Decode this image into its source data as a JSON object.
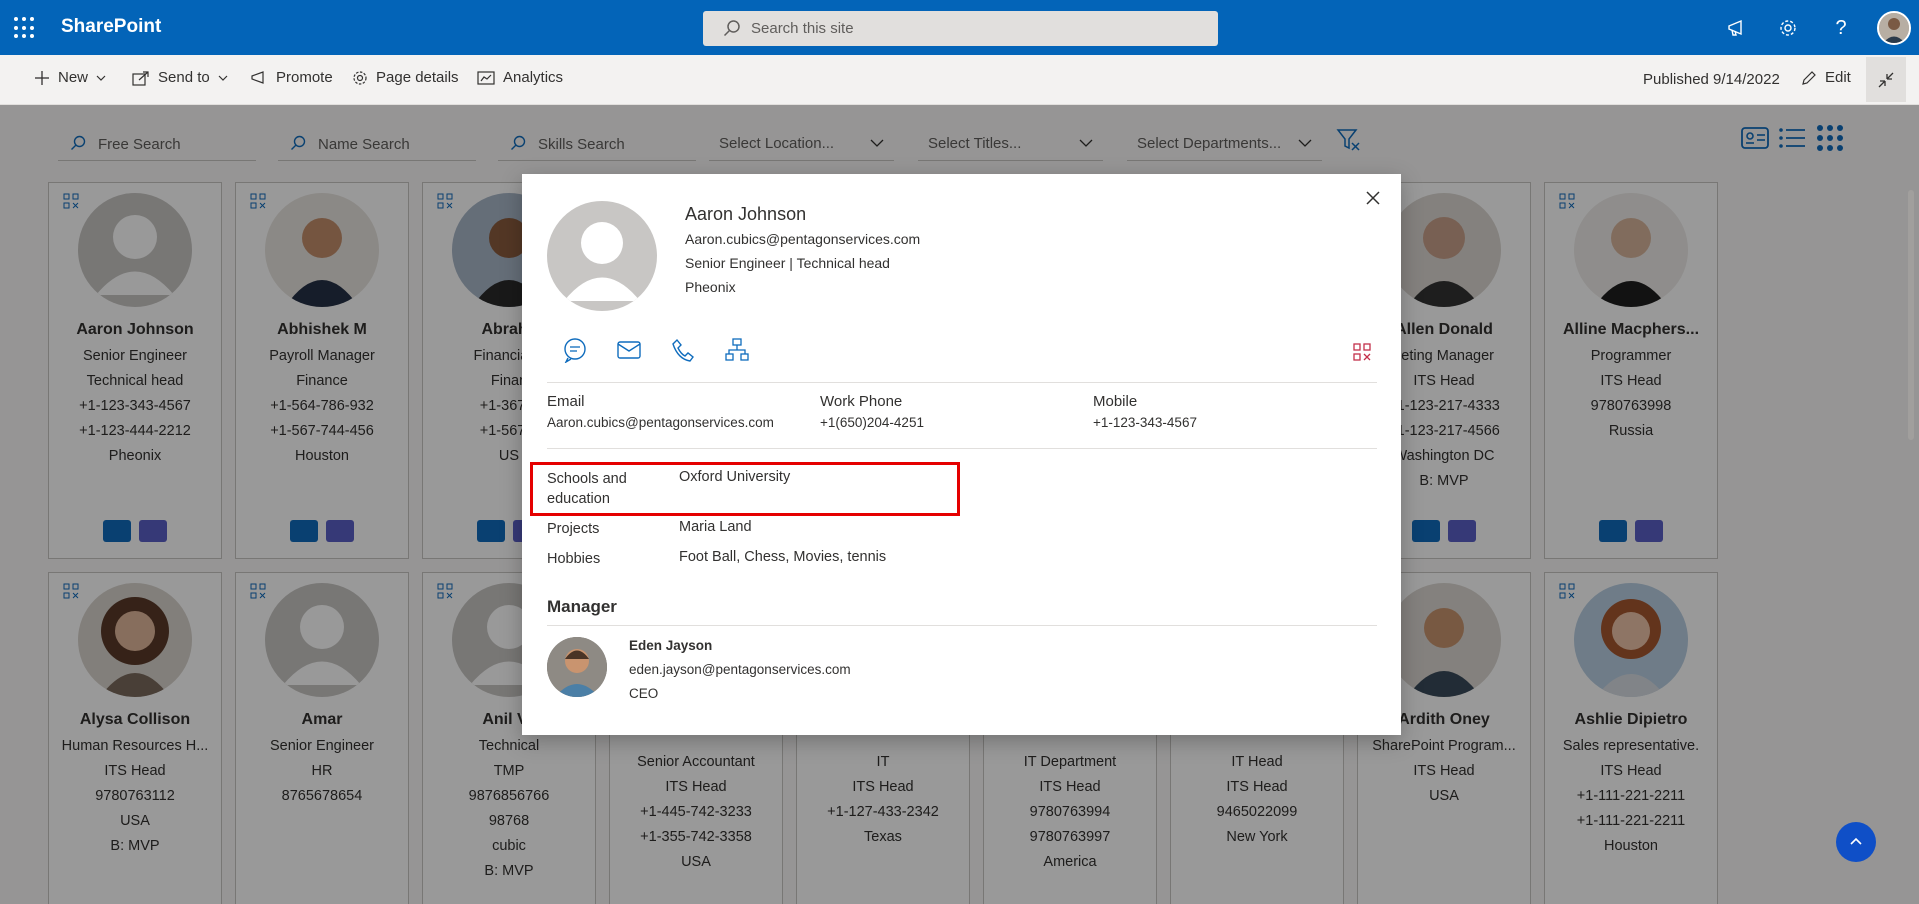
{
  "suitebar": {
    "app_name": "SharePoint",
    "search_placeholder": "Search this site"
  },
  "commandbar": {
    "new": "New",
    "send_to": "Send to",
    "promote": "Promote",
    "page_details": "Page details",
    "analytics": "Analytics",
    "published": "Published 9/14/2022",
    "edit": "Edit"
  },
  "filters": {
    "free_search": "Free Search",
    "name_search": "Name Search",
    "skills_search": "Skills Search",
    "location": "Select Location...",
    "titles": "Select Titles...",
    "departments": "Select Departments..."
  },
  "cards_row1": [
    {
      "name": "Aaron Johnson",
      "l1": "Senior Engineer",
      "l2": "Technical head",
      "l3": "+1-123-343-4567",
      "l4": "+1-123-444-2212",
      "l5": "Pheonix"
    },
    {
      "name": "Abhishek M",
      "l1": "Payroll Manager",
      "l2": "Finance",
      "l3": "+1-564-786-932",
      "l4": "+1-567-744-456",
      "l5": "Houston"
    },
    {
      "name": "Abraha",
      "l1": "Financial A",
      "l2": "Finan",
      "l3": "+1-367-3",
      "l4": "+1-567-3",
      "l5": "US"
    },
    {
      "name": "Allen Donald",
      "l1": "keting Manager",
      "l2": "ITS Head",
      "l3": "+1-123-217-4333",
      "l4": "+1-123-217-4566",
      "l5": "Washington DC",
      "l6": "B: MVP"
    },
    {
      "name": "Alline Macphers...",
      "l1": "Programmer",
      "l2": "ITS Head",
      "l3": "9780763998",
      "l5": "Russia"
    }
  ],
  "cards_row2": [
    {
      "name": "Alysa Collison",
      "l1": "Human Resources H...",
      "l2": "ITS Head",
      "l3": "9780763112",
      "l5": "USA",
      "l6": "B: MVP"
    },
    {
      "name": "Amar",
      "l1": "Senior Engineer",
      "l2": "HR",
      "l3": "8765678654"
    },
    {
      "name": "Anil Ve",
      "l1": "Technical",
      "l2": "TMP",
      "l3": "9876856766",
      "l4": "98768",
      "l5": "cubic",
      "l6": "B: MVP"
    },
    {
      "l1": "Senior Accountant",
      "l2": "ITS Head",
      "l3": "+1-445-742-3233",
      "l4": "+1-355-742-3358",
      "l5": "USA"
    },
    {
      "l1": "IT",
      "l2": "ITS Head",
      "l3": "+1-127-433-2342",
      "l5": "Texas"
    },
    {
      "l1": "IT Department",
      "l2": "ITS Head",
      "l3": "9780763994",
      "l4": "9780763997",
      "l5": "America"
    },
    {
      "l1": "IT Head",
      "l2": "ITS Head",
      "l3": "9465022099",
      "l5": "New York"
    },
    {
      "name": "Ardith Oney",
      "l1": "SharePoint Program...",
      "l2": "ITS Head",
      "l5": "USA"
    },
    {
      "name": "Ashlie Dipietro",
      "l1": "Sales representative.",
      "l2": "ITS Head",
      "l3": "+1-111-221-2211",
      "l4": "+1-111-221-2211",
      "l5": "Houston"
    }
  ],
  "profile": {
    "name": "Aaron Johnson",
    "email": "Aaron.cubics@pentagonservices.com",
    "title": "Senior Engineer | Technical head",
    "location": "Pheonix",
    "contact": {
      "email_label": "Email",
      "email_value": "Aaron.cubics@pentagonservices.com",
      "work_label": "Work Phone",
      "work_value": "+1(650)204-4251",
      "mobile_label": "Mobile",
      "mobile_value": "+1-123-343-4567"
    },
    "schools_label": "Schools and education",
    "schools_value": "Oxford University",
    "projects_label": "Projects",
    "projects_value": "Maria Land",
    "hobbies_label": "Hobbies",
    "hobbies_value": "Foot Ball, Chess, Movies, tennis",
    "manager_heading": "Manager",
    "manager": {
      "name": "Eden Jayson",
      "email": "eden.jayson@pentagonservices.com",
      "title": "CEO"
    }
  },
  "colors": {
    "suitebar": "#0364b8",
    "accent": "#0f6cbd",
    "highlight": "#e50000"
  }
}
